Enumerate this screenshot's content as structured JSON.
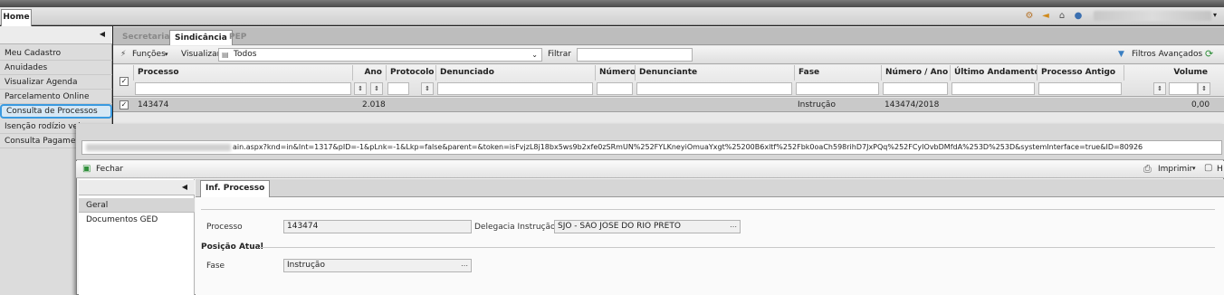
{
  "app": {
    "home_tab": "Home"
  },
  "sidebar": {
    "items": [
      {
        "label": "Meu Cadastro"
      },
      {
        "label": "Anuidades"
      },
      {
        "label": "Visualizar Agenda"
      },
      {
        "label": "Parcelamento Online"
      },
      {
        "label": "Consulta de Processos"
      },
      {
        "label": "Isenção rodízio veicu"
      },
      {
        "label": "Consulta Pagamento"
      }
    ]
  },
  "module_tabs": [
    {
      "label": "Secretaria"
    },
    {
      "label": "Sindicância"
    },
    {
      "label": "PEP"
    }
  ],
  "toolbar": {
    "funcoes": "Funções",
    "visualizar": "Visualizar",
    "view_value": "Todos",
    "filtrar": "Filtrar",
    "filtros_avancados": "Filtros Avançados"
  },
  "grid": {
    "columns": [
      "Processo",
      "Ano",
      "Protocolo",
      "Denunciado",
      "Número",
      "Denunciante",
      "Fase",
      "Número / Ano",
      "Último Andamento",
      "Processo Antigo",
      "Volume"
    ],
    "rows": [
      {
        "processo": "143474",
        "ano": "2.018",
        "fase": "Instrução",
        "numero_ano": "143474/2018",
        "volume": "0,00"
      }
    ]
  },
  "popup": {
    "url_tail": "ain.aspx?knd=in&Int=1317&pID=-1&pLnk=-1&Lkp=false&parent=&token=isFvjzL8j18bx5ws9b2xfe0zSRmUN%252FYLKneyiOmuaYxgt%25200B6xltf%252Fbk0oaCh598rihD7JxPQq%252FCyIOvbDMfdA%253D%253D&systemInterface=true&ID=80926",
    "fechar": "Fechar",
    "imprimir": "Imprimir",
    "right_cut": "H",
    "nav": [
      {
        "label": "Geral"
      },
      {
        "label": "Documentos GED"
      }
    ],
    "form_tab": "Inf. Processo",
    "processo_label": "Processo",
    "processo_value": "143474",
    "delegacia_label": "Delegacia Instrução",
    "delegacia_value": "SJO - SAO JOSE DO RIO PRETO",
    "posicao_heading": "Posição Atual",
    "fase_label": "Fase",
    "fase_value": "Instrução"
  }
}
